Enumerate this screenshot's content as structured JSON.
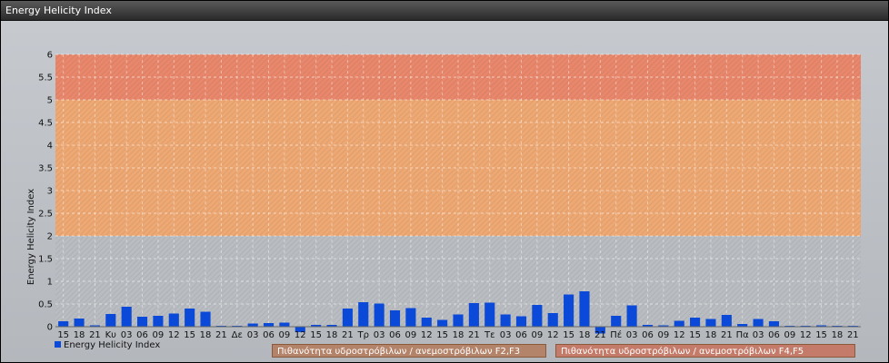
{
  "window": {
    "title": "Energy Helicity Index"
  },
  "bands": [
    {
      "from": 2,
      "to": 5,
      "color": "#eda873",
      "label": "Πιθανότητα υδροστρόβιλων / ανεμοστρόβιλων F2,F3"
    },
    {
      "from": 5,
      "to": 6,
      "color": "#e8876b",
      "label": "Πιθανότητα υδροστρόβιλων / ανεμοστρόβιλων F4,F5"
    }
  ],
  "chart_data": {
    "type": "bar",
    "ylabel": "Energy Helicity Index",
    "ylim": [
      0,
      6
    ],
    "yticks": [
      "0",
      "0.5",
      "1",
      "1.5",
      "2",
      "2.5",
      "3",
      "3.5",
      "4",
      "4.5",
      "5",
      "5.5",
      "6"
    ],
    "grid": true,
    "categories": [
      "15",
      "18",
      "21",
      "Κυ",
      "03",
      "06",
      "09",
      "12",
      "15",
      "18",
      "21",
      "Δε",
      "03",
      "06",
      "09",
      "12",
      "15",
      "18",
      "21",
      "Τρ",
      "03",
      "06",
      "09",
      "12",
      "15",
      "18",
      "21",
      "Τε",
      "03",
      "06",
      "09",
      "12",
      "15",
      "18",
      "21",
      "Πέ",
      "03",
      "06",
      "09",
      "12",
      "15",
      "18",
      "21",
      "Πα",
      "03",
      "06",
      "09",
      "12",
      "15",
      "18",
      "21"
    ],
    "series": [
      {
        "name": "Energy Helicity Index",
        "color": "#0b49d8",
        "values": [
          0.12,
          0.18,
          0.03,
          0.28,
          0.44,
          0.22,
          0.24,
          0.29,
          0.4,
          0.33,
          0.02,
          0.02,
          0.07,
          0.08,
          0.09,
          -0.12,
          0.04,
          0.04,
          0.4,
          0.54,
          0.51,
          0.36,
          0.41,
          0.2,
          0.15,
          0.27,
          0.52,
          0.53,
          0.27,
          0.23,
          0.48,
          0.3,
          0.71,
          0.78,
          -0.15,
          0.24,
          0.47,
          0.04,
          0.03,
          0.13,
          0.2,
          0.17,
          0.26,
          0.06,
          0.17,
          0.12,
          0.02,
          0.02,
          0.03,
          0.02,
          0.02
        ]
      }
    ]
  }
}
